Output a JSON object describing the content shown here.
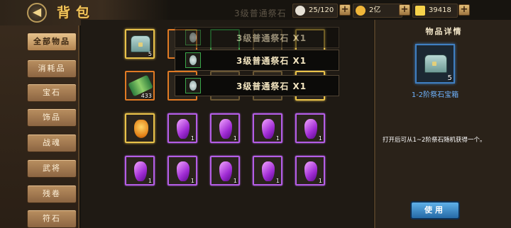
{
  "header": {
    "title": "背包",
    "back_glyph": "◀"
  },
  "resources": {
    "bag_capacity": "25/120",
    "silver": "2亿",
    "gold": "39418",
    "plus_label": "+"
  },
  "sidebar": {
    "items": [
      {
        "label": "全部物品",
        "active": true
      },
      {
        "label": "消耗品",
        "active": false
      },
      {
        "label": "宝石",
        "active": false
      },
      {
        "label": "饰品",
        "active": false
      },
      {
        "label": "战魂",
        "active": false
      },
      {
        "label": "武将",
        "active": false
      },
      {
        "label": "残卷",
        "active": false
      },
      {
        "label": "符石",
        "active": false
      }
    ]
  },
  "grid": {
    "row1": [
      {
        "count": "5",
        "kind": "chest"
      }
    ],
    "row2": [
      {
        "count": "433",
        "kind": "scroll"
      }
    ],
    "row3": [
      {
        "count": "",
        "kind": "amulet"
      },
      {
        "count": "1",
        "kind": "crystal"
      },
      {
        "count": "1",
        "kind": "crystal"
      },
      {
        "count": "1",
        "kind": "crystal"
      },
      {
        "count": "1",
        "kind": "crystal"
      }
    ],
    "row4": [
      {
        "count": "1",
        "kind": "crystal"
      },
      {
        "count": "1",
        "kind": "crystal"
      },
      {
        "count": "1",
        "kind": "crystal"
      },
      {
        "count": "1",
        "kind": "crystal"
      },
      {
        "count": "1",
        "kind": "crystal"
      }
    ]
  },
  "popup": {
    "ghost_top": "3级普通祭石",
    "rows": [
      "3级普通祭石 X1",
      "3级普通祭石 X1",
      "3级普通祭石 X1"
    ]
  },
  "detail": {
    "heading": "物品详情",
    "item_count": "5",
    "item_name": "1-2阶祭石宝箱",
    "description": "打开后可从1~2阶祭石随机获得一个。",
    "use_label": "使用"
  },
  "colors": {
    "accent_gold": "#f3c65a",
    "use_button": "#3a8cd0",
    "item_name_blue": "#6fb4ff"
  }
}
